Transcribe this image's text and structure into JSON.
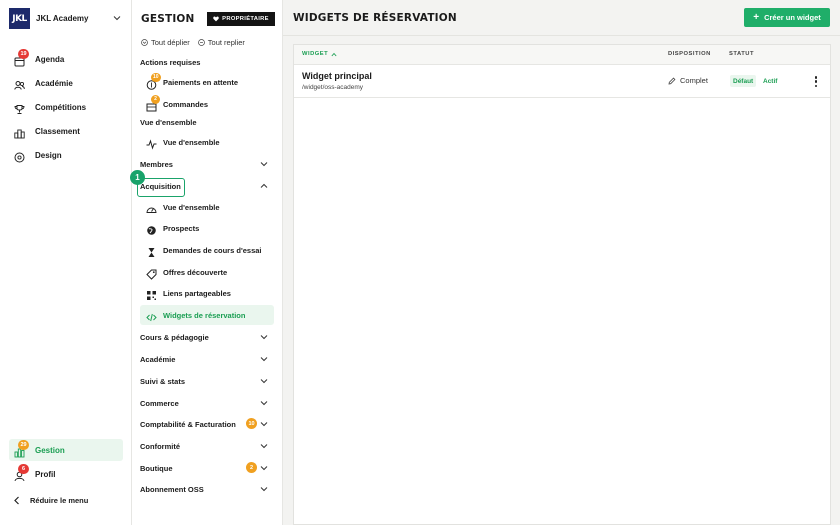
{
  "app": {
    "brand_name": "JKL Academy",
    "logo_text": "JKL",
    "accent_color": "#1a9e52",
    "icon_brand_chevron": "chevron-down-icon"
  },
  "rail": {
    "items": [
      {
        "label": "Agenda",
        "icon": "calendar-icon",
        "badge": "19"
      },
      {
        "label": "Académie",
        "icon": "users-icon"
      },
      {
        "label": "Compétitions",
        "icon": "trophy-icon"
      },
      {
        "label": "Classement",
        "icon": "podium-icon"
      },
      {
        "label": "Design",
        "icon": "palette-icon"
      }
    ],
    "bottom": [
      {
        "label": "Gestion",
        "icon": "chart-icon",
        "badge": "29",
        "active": true
      },
      {
        "label": "Profil",
        "icon": "user-icon",
        "badge": "6"
      }
    ],
    "collapse_label": "Réduire le menu"
  },
  "subnav": {
    "title": "GESTION",
    "owner_badge": "PROPRIÉTAIRE",
    "expand_all": "Tout déplier",
    "collapse_all": "Tout replier",
    "actions_title": "Actions requises",
    "actions": [
      {
        "label": "Paiements en attente",
        "badge": "10",
        "icon": "payment-icon"
      },
      {
        "label": "Commandes",
        "badge": "2",
        "icon": "cart-icon"
      }
    ],
    "overview_title": "Vue d'ensemble",
    "overview_item": "Vue d'ensemble",
    "groups_top": [
      {
        "label": "Membres"
      }
    ],
    "acquisition": {
      "label": "Acquisition",
      "step_number": "1",
      "items": [
        {
          "label": "Vue d'ensemble",
          "icon": "gauge-icon"
        },
        {
          "label": "Prospects",
          "icon": "globe-icon"
        },
        {
          "label": "Demandes de cours d'essai",
          "icon": "hourglass-icon"
        },
        {
          "label": "Offres découverte",
          "icon": "tag-icon"
        },
        {
          "label": "Liens partageables",
          "icon": "qrcode-icon"
        },
        {
          "label": "Widgets de réservation",
          "icon": "code-icon",
          "active": true
        }
      ]
    },
    "groups_bottom": [
      {
        "label": "Cours & pédagogie"
      },
      {
        "label": "Académie"
      },
      {
        "label": "Suivi & stats"
      },
      {
        "label": "Commerce"
      },
      {
        "label": "Comptabilité & Facturation",
        "badge": "10"
      },
      {
        "label": "Conformité"
      },
      {
        "label": "Boutique",
        "badge": "2"
      },
      {
        "label": "Abonnement OSS"
      }
    ]
  },
  "main": {
    "title": "WIDGETS DE RÉSERVATION",
    "create_button": "Créer un widget",
    "table": {
      "headers": {
        "widget": "WIDGET",
        "disposition": "DISPOSITION",
        "status": "STATUT"
      },
      "rows": [
        {
          "name": "Widget principal",
          "path": "/widget/oss-academy",
          "disposition": "Complet",
          "tag_default": "Défaut",
          "tag_active": "Actif"
        }
      ]
    }
  }
}
